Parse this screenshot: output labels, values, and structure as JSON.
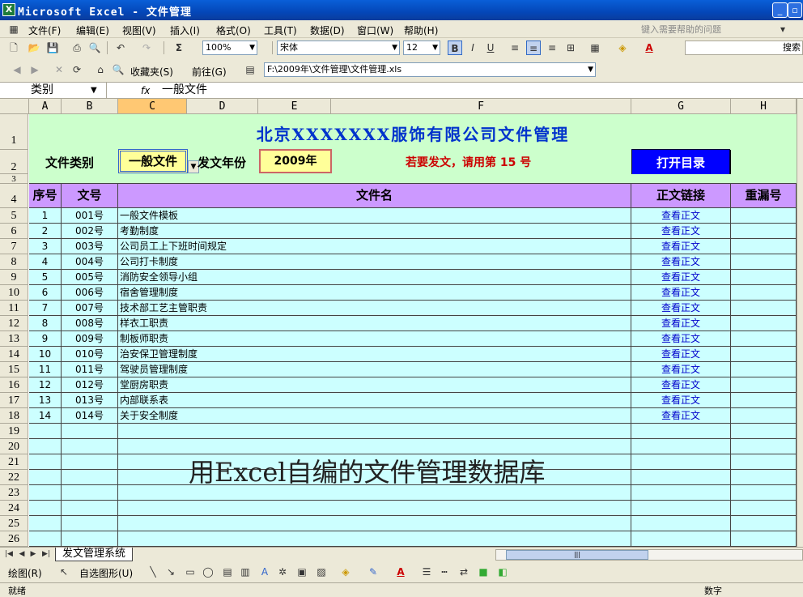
{
  "window": {
    "title": "Microsoft Excel - 文件管理",
    "icon": "excel-icon"
  },
  "menu": [
    "文件(F)",
    "编辑(E)",
    "视图(V)",
    "插入(I)",
    "格式(O)",
    "工具(T)",
    "数据(D)",
    "窗口(W)",
    "帮助(H)"
  ],
  "help_placeholder": "键入需要帮助的问题",
  "toolbar": {
    "zoom": "100%",
    "font": "宋体",
    "size": "12",
    "bold": "B",
    "italic": "I",
    "underline": "U",
    "search_label": "搜索"
  },
  "web_toolbar": {
    "favorites": "收藏夹(S)",
    "goto": "前往(G)",
    "path": "F:\\2009年\\文件管理\\文件管理.xls"
  },
  "formula": {
    "name_box": "类别",
    "fx": "fx",
    "value": "一般文件"
  },
  "columns": [
    "A",
    "B",
    "C",
    "D",
    "E",
    "F",
    "G",
    "H"
  ],
  "rows": [
    "1",
    "2",
    "3",
    "4",
    "5",
    "6",
    "7",
    "8",
    "9",
    "10",
    "11",
    "12",
    "13",
    "14",
    "15",
    "16",
    "17",
    "18",
    "19",
    "20",
    "21",
    "22",
    "23",
    "24",
    "25",
    "26"
  ],
  "sheet": {
    "title": "北京XXXXXXX服饰有限公司文件管理",
    "category_label": "文件类别",
    "category_value": "一般文件",
    "year_label": "发文年份",
    "year_value": "2009年",
    "notice": "若要发文，请用第 15 号",
    "open_button": "打开目录",
    "headers": {
      "seq": "序号",
      "docno": "文号",
      "name": "文件名",
      "link": "正文链接",
      "dup": "重漏号"
    },
    "records": [
      {
        "seq": "1",
        "no": "001号",
        "name": "一般文件模板",
        "link": "查看正文"
      },
      {
        "seq": "2",
        "no": "002号",
        "name": "考勤制度",
        "link": "查看正文"
      },
      {
        "seq": "3",
        "no": "003号",
        "name": "公司员工上下班时间规定",
        "link": "查看正文"
      },
      {
        "seq": "4",
        "no": "004号",
        "name": "公司打卡制度",
        "link": "查看正文"
      },
      {
        "seq": "5",
        "no": "005号",
        "name": "消防安全领导小组",
        "link": "查看正文"
      },
      {
        "seq": "6",
        "no": "006号",
        "name": "宿舍管理制度",
        "link": "查看正文"
      },
      {
        "seq": "7",
        "no": "007号",
        "name": "技术部工艺主管职责",
        "link": "查看正文"
      },
      {
        "seq": "8",
        "no": "008号",
        "name": "样衣工职责",
        "link": "查看正文"
      },
      {
        "seq": "9",
        "no": "009号",
        "name": "制板师职责",
        "link": "查看正文"
      },
      {
        "seq": "10",
        "no": "010号",
        "name": "治安保卫管理制度",
        "link": "查看正文"
      },
      {
        "seq": "11",
        "no": "011号",
        "name": "驾驶员管理制度",
        "link": "查看正文"
      },
      {
        "seq": "12",
        "no": "012号",
        "name": "堂厨房职责",
        "link": "查看正文"
      },
      {
        "seq": "13",
        "no": "013号",
        "name": "内部联系表",
        "link": "查看正文"
      },
      {
        "seq": "14",
        "no": "014号",
        "name": "关于安全制度",
        "link": "查看正文"
      }
    ],
    "watermark": "用Excel自编的文件管理数据库"
  },
  "sheet_tab": "发文管理系统",
  "drawbar": {
    "draw": "绘图(R)",
    "autoshapes": "自选图形(U)"
  },
  "status": {
    "left": "就绪",
    "right": "数字"
  },
  "colors": {
    "title_green": "#ccffcc",
    "header_purple": "#cc99ff",
    "row_cyan": "#ccffff",
    "title_blue": "#0033cc",
    "notice_red": "#cc0000",
    "button_blue": "#0000ff"
  }
}
